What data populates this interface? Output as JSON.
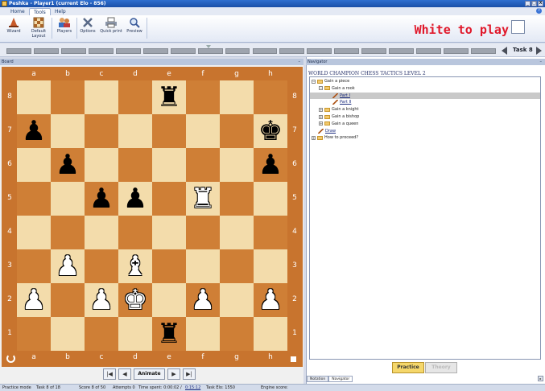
{
  "window": {
    "title": "Peshka - Player1 (current Elo - 856)",
    "min_glyph": "_",
    "max_glyph": "□",
    "close_glyph": "X"
  },
  "menu": {
    "tabs": [
      "Home",
      "Tools",
      "Help"
    ],
    "active_tab": "Tools",
    "help_glyph": "?"
  },
  "ribbon": {
    "buttons": [
      {
        "label_lines": [
          "Wizard"
        ],
        "icon": "wizard-hat-icon"
      },
      {
        "label_lines": [
          "Default",
          "Layout"
        ],
        "icon": "chessboard-layout-icon"
      },
      {
        "label_lines": [
          "Players"
        ],
        "icon": "players-icon"
      },
      {
        "label_lines": [
          "Options"
        ],
        "icon": "tools-icon"
      },
      {
        "label_lines": [
          "Quick print"
        ],
        "icon": "printer-icon"
      },
      {
        "label_lines": [
          "Preview"
        ],
        "icon": "magnifier-icon"
      }
    ],
    "to_play": "White to play"
  },
  "task_nav": {
    "label": "Task 8",
    "segment_count": 18
  },
  "board": {
    "panel_title": "Board",
    "files": [
      "a",
      "b",
      "c",
      "d",
      "e",
      "f",
      "g",
      "h"
    ],
    "ranks": [
      "8",
      "7",
      "6",
      "5",
      "4",
      "3",
      "2",
      "1"
    ],
    "pieces": [
      {
        "square": "e8",
        "glyph": "♜",
        "color": "black",
        "name": "black-rook-e8"
      },
      {
        "square": "a7",
        "glyph": "♟",
        "color": "black",
        "name": "black-pawn-a7"
      },
      {
        "square": "h7",
        "glyph": "♚",
        "color": "black",
        "name": "black-king-h7"
      },
      {
        "square": "b6",
        "glyph": "♟",
        "color": "black",
        "name": "black-pawn-b6"
      },
      {
        "square": "h6",
        "glyph": "♟",
        "color": "black",
        "name": "black-pawn-h6"
      },
      {
        "square": "c5",
        "glyph": "♟",
        "color": "black",
        "name": "black-pawn-c5"
      },
      {
        "square": "d5",
        "glyph": "♟",
        "color": "black",
        "name": "black-pawn-d5"
      },
      {
        "square": "f5",
        "glyph": "♜",
        "color": "white",
        "name": "white-rook-f5"
      },
      {
        "square": "b3",
        "glyph": "♟",
        "color": "white",
        "name": "white-pawn-b3"
      },
      {
        "square": "d3",
        "glyph": "♝",
        "color": "white",
        "name": "white-bishop-d3"
      },
      {
        "square": "a2",
        "glyph": "♟",
        "color": "white",
        "name": "white-pawn-a2"
      },
      {
        "square": "c2",
        "glyph": "♟",
        "color": "white",
        "name": "white-pawn-c2"
      },
      {
        "square": "d2",
        "glyph": "♚",
        "color": "white",
        "name": "white-king-d2"
      },
      {
        "square": "f2",
        "glyph": "♟",
        "color": "white",
        "name": "white-pawn-f2"
      },
      {
        "square": "h2",
        "glyph": "♟",
        "color": "white",
        "name": "white-pawn-h2"
      },
      {
        "square": "e1",
        "glyph": "♜",
        "color": "black",
        "name": "black-rook-e1"
      }
    ],
    "nav": {
      "first": "|◀",
      "prev": "◀",
      "animate": "Animate",
      "next": "▶",
      "last": "▶|"
    }
  },
  "navigator": {
    "panel_title": "Navigator",
    "collapse_glyph": "–",
    "book_title": "WORLD CHAMPION CHESS TACTICS LEVEL 2",
    "items": [
      {
        "label": "Gain a piece",
        "level": 0,
        "expander": "−",
        "icon": "folder",
        "link": false
      },
      {
        "label": "Gain a rook",
        "level": 1,
        "expander": "−",
        "icon": "folder",
        "link": false
      },
      {
        "label": "Part I",
        "level": 2,
        "expander": "",
        "icon": "pencil",
        "link": true,
        "selected": true
      },
      {
        "label": "Part II",
        "level": 2,
        "expander": "",
        "icon": "pencil",
        "link": true
      },
      {
        "label": "Gain a knight",
        "level": 1,
        "expander": "+",
        "icon": "folder",
        "link": false
      },
      {
        "label": "Gain a bishop",
        "level": 1,
        "expander": "+",
        "icon": "folder",
        "link": false
      },
      {
        "label": "Gain a queen",
        "level": 1,
        "expander": "+",
        "icon": "folder",
        "link": false
      },
      {
        "label": "Draw",
        "level": 0,
        "expander": "",
        "icon": "pencil",
        "link": true
      },
      {
        "label": "How to proceed?",
        "level": 0,
        "expander": "+",
        "icon": "folder",
        "link": false
      }
    ],
    "practice_label": "Practice",
    "theory_label": "Theory",
    "bottom_tabs": [
      "Notation",
      "Navigator"
    ],
    "active_bottom_tab": "Navigator",
    "scroll_glyph": "▸"
  },
  "status": {
    "mode": "Practice mode",
    "task": "Task 8 of 18",
    "score": "Score 8 of 50",
    "attempts": "Attempts 0",
    "time_spent": "Time spent: 0:00:02 /",
    "time_limit": "0:15:12",
    "task_elo": "Task Elo: 1550",
    "engine_score": "Engine score:"
  },
  "colors": {
    "light_square": "#f3dcab",
    "dark_square": "#cf7f36",
    "to_play_red": "#e0192b"
  }
}
